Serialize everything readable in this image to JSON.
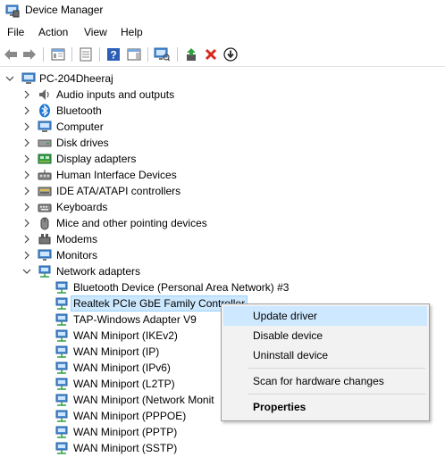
{
  "window": {
    "title": "Device Manager"
  },
  "menubar": {
    "items": [
      "File",
      "Action",
      "View",
      "Help"
    ]
  },
  "toolbar": {
    "buttons": [
      "back-icon",
      "forward-icon",
      "show-hide-console-tree-icon",
      "properties-icon",
      "help-icon",
      "action-pane-icon",
      "scan-hardware-icon",
      "update-driver-icon",
      "uninstall-icon",
      "disable-device-icon"
    ]
  },
  "tree": {
    "root": "PC-204Dheeraj",
    "categories": [
      "Audio inputs and outputs",
      "Bluetooth",
      "Computer",
      "Disk drives",
      "Display adapters",
      "Human Interface Devices",
      "IDE ATA/ATAPI controllers",
      "Keyboards",
      "Mice and other pointing devices",
      "Modems",
      "Monitors",
      "Network adapters"
    ],
    "network_adapters": [
      "Bluetooth Device (Personal Area Network) #3",
      "Realtek PCIe GbE Family Controller",
      "TAP-Windows Adapter V9",
      "WAN Miniport (IKEv2)",
      "WAN Miniport (IP)",
      "WAN Miniport (IPv6)",
      "WAN Miniport (L2TP)",
      "WAN Miniport (Network Monit",
      "WAN Miniport (PPPOE)",
      "WAN Miniport (PPTP)",
      "WAN Miniport (SSTP)"
    ]
  },
  "context_menu": {
    "items": [
      "Update driver",
      "Disable device",
      "Uninstall device",
      "Scan for hardware changes",
      "Properties"
    ]
  },
  "colors": {
    "selection": "#cce8ff",
    "accent_blue": "#1e78d7",
    "delete_red": "#d9261c",
    "green": "#2ea043"
  }
}
